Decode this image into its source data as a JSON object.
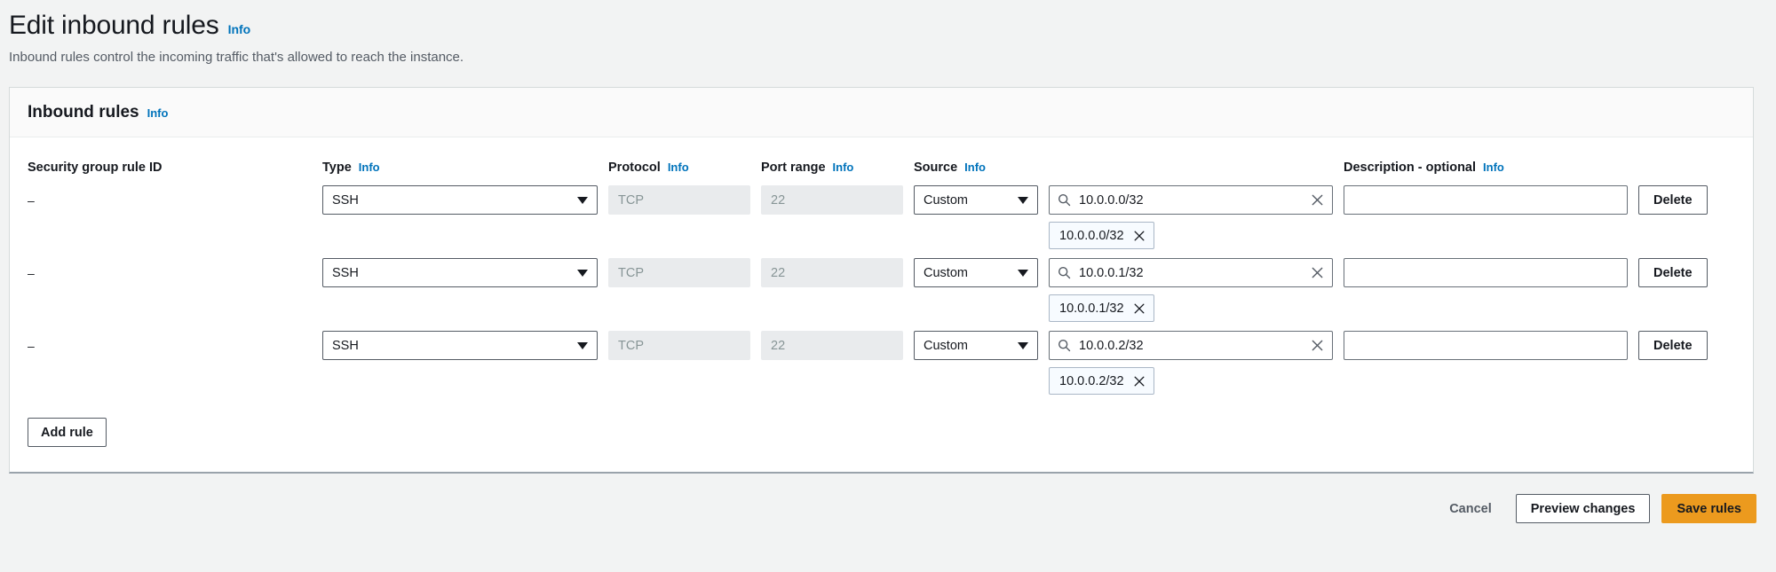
{
  "page": {
    "title": "Edit inbound rules",
    "info_label": "Info",
    "description": "Inbound rules control the incoming traffic that's allowed to reach the instance."
  },
  "panel": {
    "title": "Inbound rules",
    "info_label": "Info"
  },
  "columns": {
    "rule_id": "Security group rule ID",
    "type": "Type",
    "protocol": "Protocol",
    "port_range": "Port range",
    "source": "Source",
    "description": "Description - optional",
    "info_label": "Info"
  },
  "rules": [
    {
      "rule_id": "–",
      "type": "SSH",
      "protocol": "TCP",
      "port_range": "22",
      "source_type": "Custom",
      "source_value": "10.0.0.0/32",
      "source_token": "10.0.0.0/32",
      "description": "",
      "delete_label": "Delete"
    },
    {
      "rule_id": "–",
      "type": "SSH",
      "protocol": "TCP",
      "port_range": "22",
      "source_type": "Custom",
      "source_value": "10.0.0.1/32",
      "source_token": "10.0.0.1/32",
      "description": "",
      "delete_label": "Delete"
    },
    {
      "rule_id": "–",
      "type": "SSH",
      "protocol": "TCP",
      "port_range": "22",
      "source_type": "Custom",
      "source_value": "10.0.0.2/32",
      "source_token": "10.0.0.2/32",
      "description": "",
      "delete_label": "Delete"
    }
  ],
  "actions": {
    "add_rule": "Add rule",
    "cancel": "Cancel",
    "preview_changes": "Preview changes",
    "save_rules": "Save rules"
  },
  "colors": {
    "accent_link": "#0073bb",
    "primary_button": "#ec9a1e",
    "page_background": "#f2f3f3",
    "panel_background": "#ffffff",
    "disabled_field": "#e9ebed"
  }
}
